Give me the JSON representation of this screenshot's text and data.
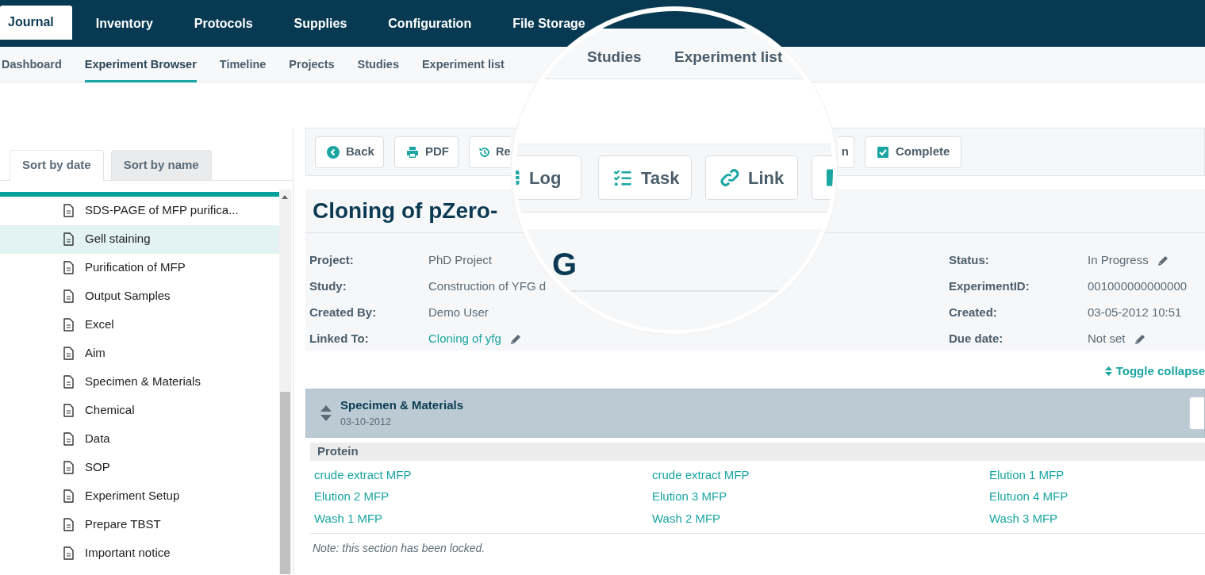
{
  "top_nav": [
    {
      "label": "Journal",
      "selected": true
    },
    {
      "label": "Inventory",
      "selected": false
    },
    {
      "label": "Protocols",
      "selected": false
    },
    {
      "label": "Supplies",
      "selected": false
    },
    {
      "label": "Configuration",
      "selected": false
    },
    {
      "label": "File Storage",
      "selected": false
    }
  ],
  "sub_nav": [
    {
      "label": "Dashboard",
      "selected": false
    },
    {
      "label": "Experiment Browser",
      "selected": true
    },
    {
      "label": "Timeline",
      "selected": false
    },
    {
      "label": "Projects",
      "selected": false
    },
    {
      "label": "Studies",
      "selected": false
    },
    {
      "label": "Experiment list",
      "selected": false
    }
  ],
  "sidebar": {
    "tabs": [
      {
        "label": "Sort by date",
        "selected": true
      },
      {
        "label": "Sort by name",
        "selected": false
      }
    ],
    "items": [
      {
        "label": "SDS-PAGE of MFP purifica...",
        "selected": false
      },
      {
        "label": "Gell staining",
        "selected": true
      },
      {
        "label": "Purification of MFP",
        "selected": false
      },
      {
        "label": "Output Samples",
        "selected": false
      },
      {
        "label": "Excel",
        "selected": false
      },
      {
        "label": "Aim",
        "selected": false
      },
      {
        "label": "Specimen & Materials",
        "selected": false
      },
      {
        "label": "Chemical",
        "selected": false
      },
      {
        "label": "Data",
        "selected": false
      },
      {
        "label": "SOP",
        "selected": false
      },
      {
        "label": "Experiment Setup",
        "selected": false
      },
      {
        "label": "Prepare TBST",
        "selected": false
      },
      {
        "label": "Important notice",
        "selected": false
      }
    ]
  },
  "toolbar": [
    {
      "label": "Back",
      "kind": "back"
    },
    {
      "label": "PDF",
      "kind": "print"
    },
    {
      "label": "Re",
      "kind": "history"
    },
    {
      "label": "n",
      "kind": "plain"
    },
    {
      "label": "Complete",
      "kind": "check"
    }
  ],
  "title": "Cloning of pZero-",
  "details_left": [
    {
      "label": "Project:",
      "value": "PhD Project",
      "link": false,
      "editable": false
    },
    {
      "label": "Study:",
      "value": "Construction of YFG d",
      "link": false,
      "editable": false
    },
    {
      "label": "Created By:",
      "value": "Demo User",
      "link": false,
      "editable": false
    },
    {
      "label": "Linked To:",
      "value": "Cloning of yfg",
      "link": true,
      "editable": true
    }
  ],
  "details_right": [
    {
      "label": "Status:",
      "value": "In Progress",
      "link": false,
      "editable": true
    },
    {
      "label": "ExperimentID:",
      "value": "001000000000000",
      "link": false,
      "editable": false
    },
    {
      "label": "Created:",
      "value": "03-05-2012 10:51",
      "link": false,
      "editable": false
    },
    {
      "label": "Due date:",
      "value": "Not set",
      "link": false,
      "editable": true
    }
  ],
  "toggle": "Toggle collapse",
  "section": {
    "title": "Specimen & Materials",
    "date": "03-10-2012",
    "group": "Protein",
    "items": [
      "crude extract MFP",
      "crude extract MFP",
      "Elution 1 MFP",
      "Elution 2 MFP",
      "Elution 3 MFP",
      "Elutuon 4 MFP",
      "Wash 1 MFP",
      "Wash 2 MFP",
      "Wash 3 MFP"
    ],
    "note": "Note: this section has been locked."
  },
  "magnifier": {
    "sub_nav": [
      "Studies",
      "Experiment list"
    ],
    "buttons": [
      {
        "label": "Log",
        "kind": "list"
      },
      {
        "label": "Task",
        "kind": "tasks"
      },
      {
        "label": "Link",
        "kind": "link"
      },
      {
        "kind": "partial"
      }
    ],
    "title_fragment": "G"
  }
}
